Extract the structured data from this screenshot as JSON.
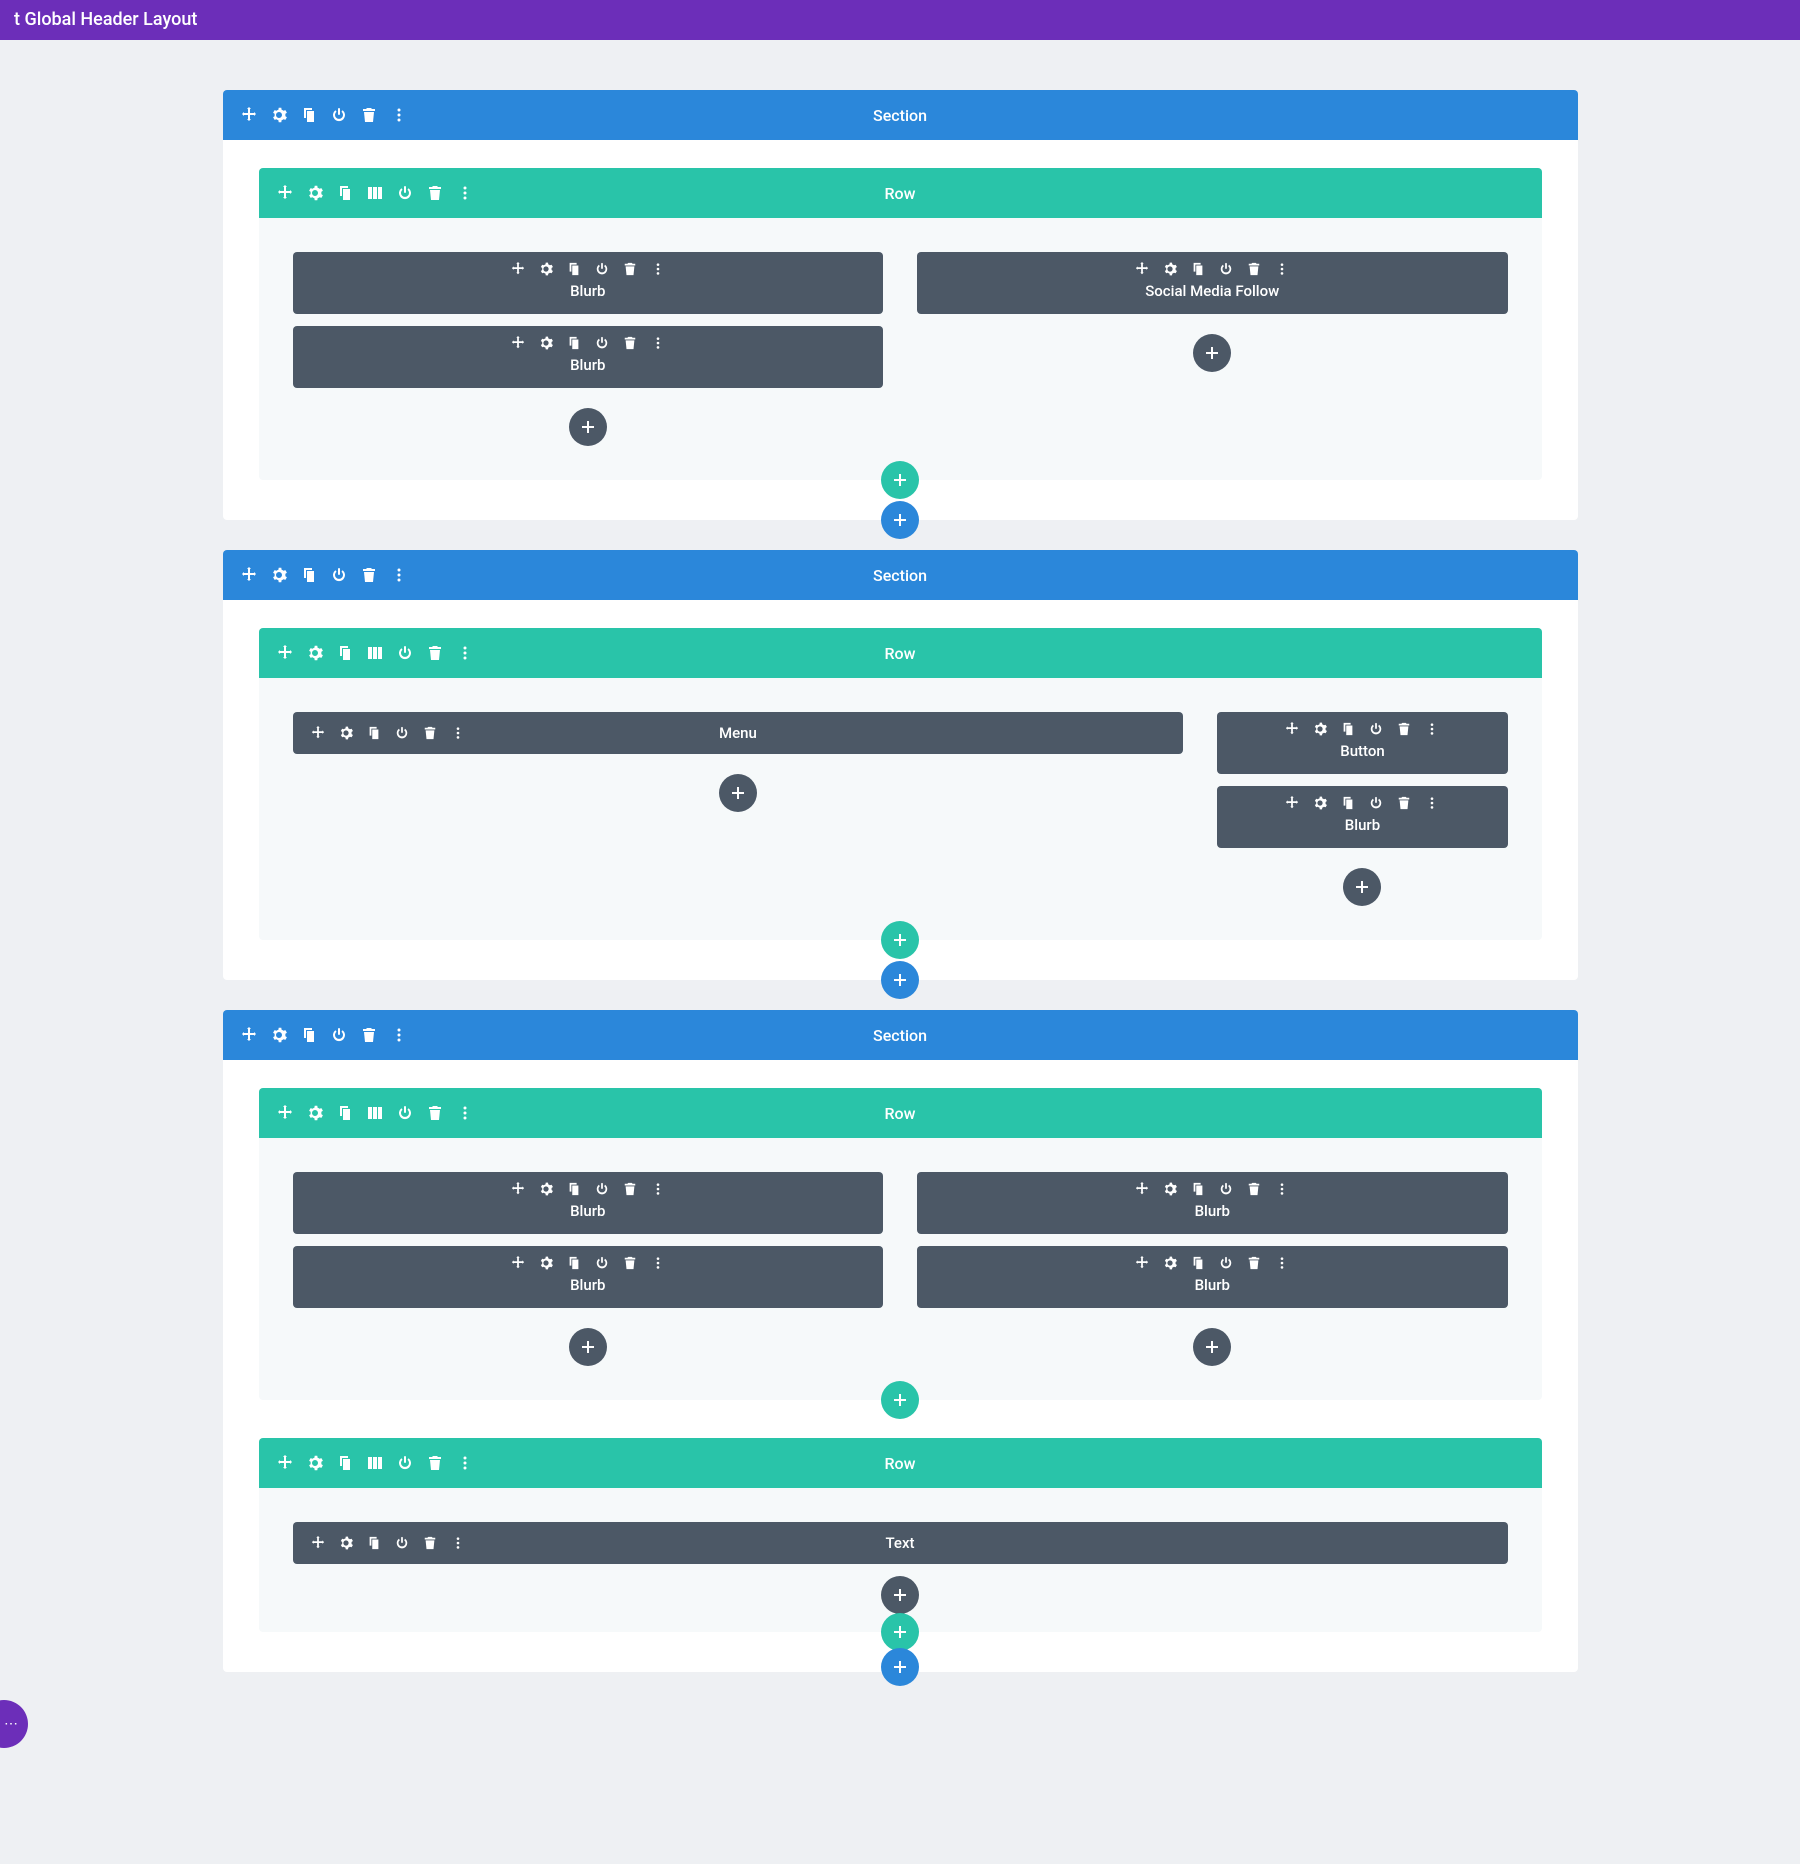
{
  "topbar": {
    "title": "t Global Header Layout"
  },
  "labels": {
    "section": "Section",
    "row": "Row"
  },
  "buttons": {
    "add": "+",
    "more": "⋯"
  },
  "sections": [
    {
      "rows": [
        {
          "layout": "two-col",
          "cols": [
            {
              "modules": [
                "Blurb",
                "Blurb"
              ]
            },
            {
              "modules": [
                "Social Media Follow"
              ]
            }
          ]
        }
      ]
    },
    {
      "rows": [
        {
          "layout": "wide-narrow",
          "cols": [
            {
              "modules": [
                "Menu"
              ]
            },
            {
              "modules": [
                "Button",
                "Blurb"
              ]
            }
          ]
        }
      ]
    },
    {
      "rows": [
        {
          "layout": "two-col",
          "cols": [
            {
              "modules": [
                "Blurb",
                "Blurb"
              ]
            },
            {
              "modules": [
                "Blurb",
                "Blurb"
              ]
            }
          ]
        },
        {
          "layout": "one-col",
          "cols": [
            {
              "modules": [
                "Text"
              ]
            }
          ]
        }
      ]
    }
  ]
}
